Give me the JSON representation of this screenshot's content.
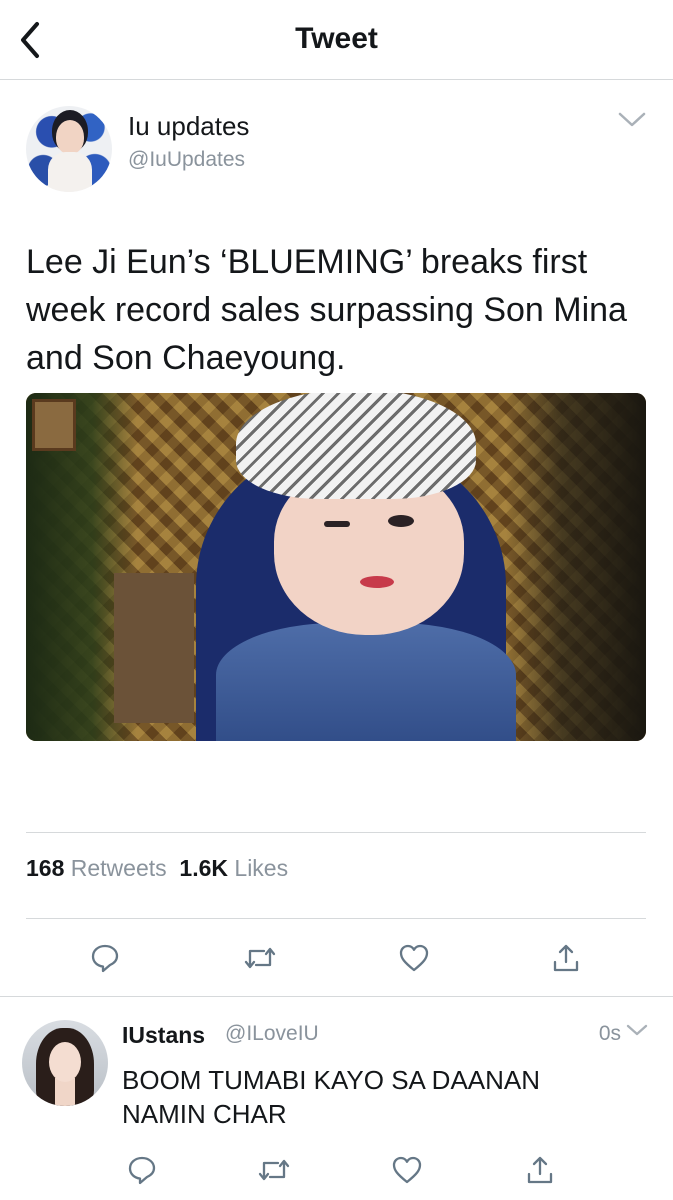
{
  "nav": {
    "title": "Tweet",
    "back_icon": "chevron-left-icon"
  },
  "tweet": {
    "author_name": "Iu updates",
    "author_handle": "@IuUpdates",
    "text": "Lee Ji Eun’s ‘BLUEMING’ breaks first week record sales surpassing Son Mina and Son Chaeyoung.",
    "stats": {
      "retweets_count": "168",
      "retweets_label": "Retweets",
      "likes_count": "1.6K",
      "likes_label": "Likes"
    },
    "actions": [
      "reply-icon",
      "retweet-icon",
      "like-icon",
      "share-icon"
    ]
  },
  "reply": {
    "author_name": "IUstans",
    "author_handle": "@ILoveIU",
    "time": "0s",
    "text": "BOOM TUMABI KAYO SA DAANAN NAMIN CHAR",
    "actions": [
      "reply-icon",
      "retweet-icon",
      "like-icon",
      "share-icon"
    ]
  },
  "colors": {
    "text": "#14171a",
    "secondary": "#8a939c",
    "divider": "#d6d9db",
    "icon": "#657786"
  }
}
